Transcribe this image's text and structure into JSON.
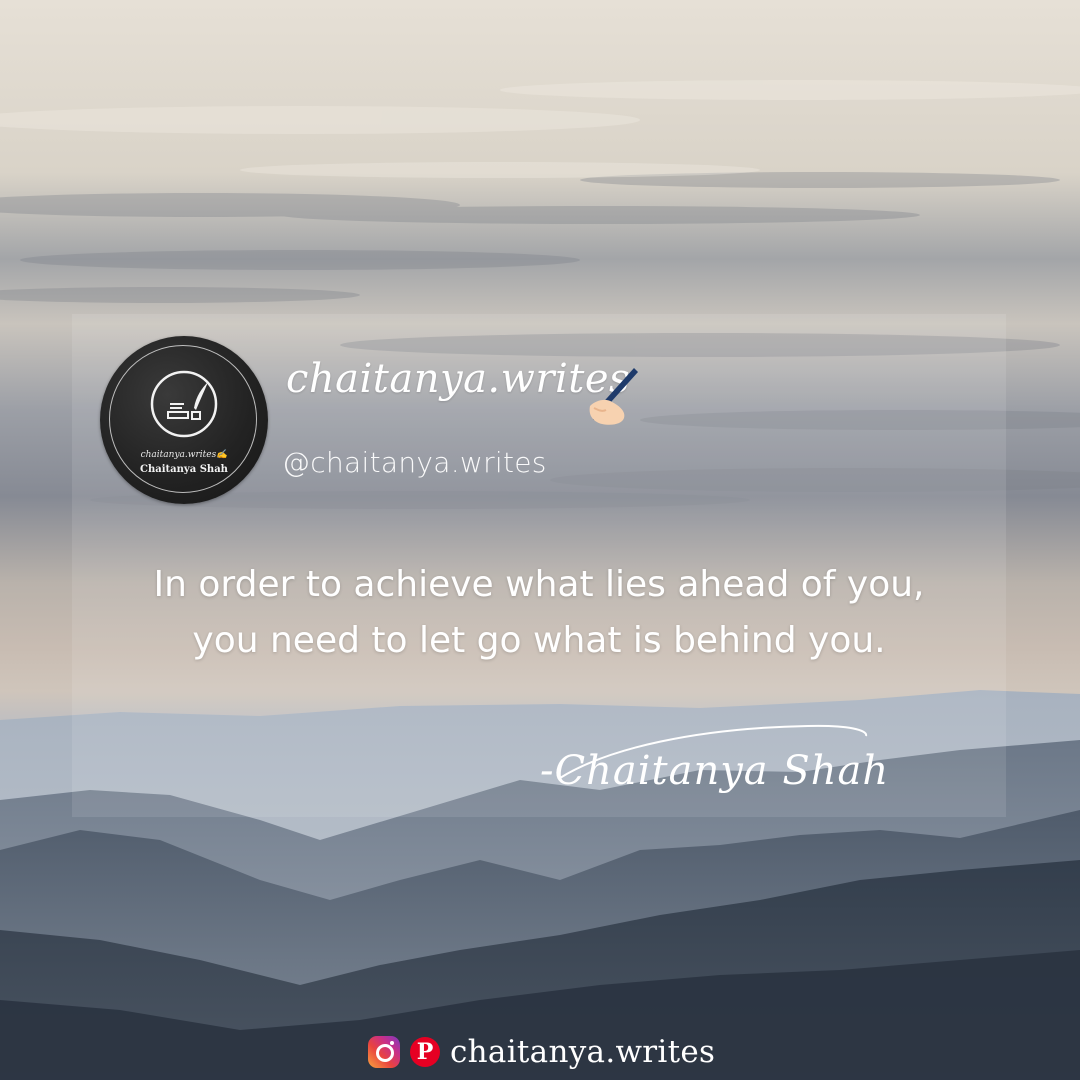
{
  "brand": {
    "script_name": "chaitanya.writes",
    "handle": "@chaitanya.writes",
    "logo_handle": "chaitanya.writes✍",
    "logo_name": "Chaitanya Shah"
  },
  "quote": {
    "line1": "In order to achieve what lies ahead of you,",
    "line2": "you need to let go what is behind you."
  },
  "signature": "-Chaitanya Shah",
  "footer": {
    "handle": "chaitanya.writes",
    "icons": [
      "instagram-icon",
      "pinterest-icon"
    ]
  },
  "colors": {
    "text": "#ffffff",
    "logo_bg": "#232323",
    "pinterest": "#e60023"
  }
}
